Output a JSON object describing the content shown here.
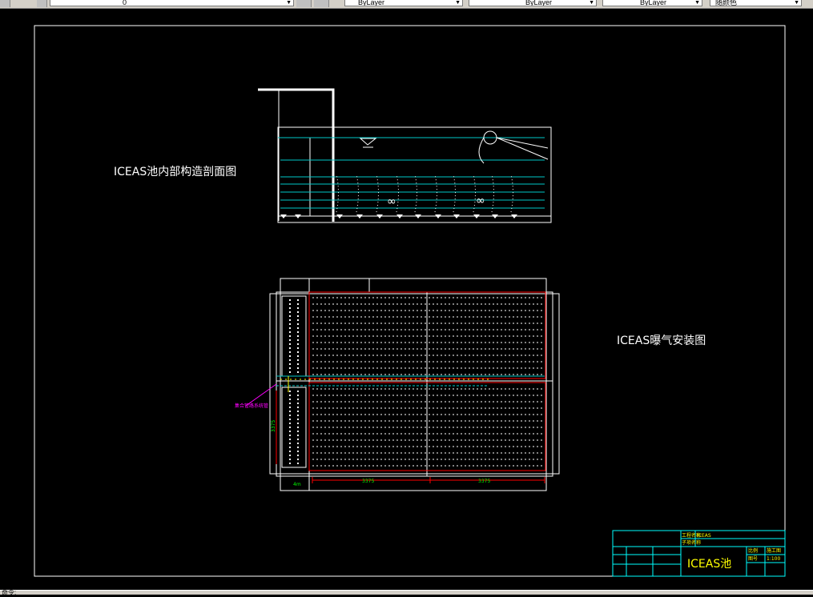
{
  "toolbar": {
    "layer_value": "0",
    "color_value": "ByLayer",
    "linetype_value": "ByLayer",
    "lineweight_value": "ByLayer",
    "plotstyle_value": "随颜色"
  },
  "drawing": {
    "section_title": "ICEAS池内部构造剖面图",
    "plan_title": "ICEAS曝气安装图",
    "side_note": "集合管路系统管",
    "dim_left": "3375",
    "dim_right": "3375",
    "dim_vertical": "3375",
    "dim_small": "4m"
  },
  "title_block": {
    "project_label": "工程名称",
    "project_value": "ICEAS",
    "subitem_label": "子项名称",
    "drawing_name": "ICEAS池",
    "scale_label": "比例",
    "scale_value": "1:100",
    "sheet_label": "图号",
    "sheet_value": "施工图"
  },
  "status": {
    "command_prompt": "命令:"
  },
  "colors": {
    "frame": "#ffffff",
    "water": "#00c8c8",
    "pipe": "#ff0000",
    "air": "#ffff00",
    "titleblock": "#00ffff"
  }
}
